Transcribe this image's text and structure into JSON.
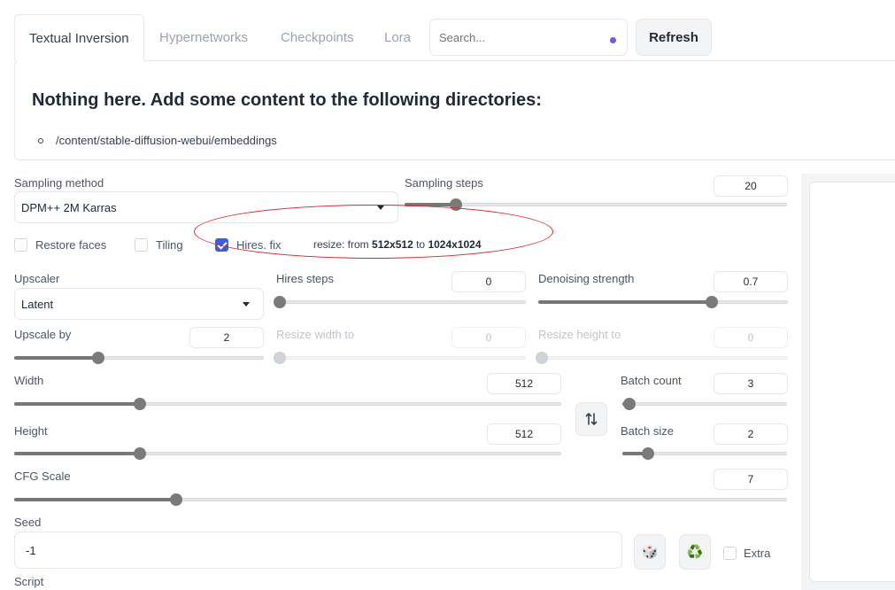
{
  "tabs": [
    {
      "label": "Textual Inversion",
      "active": true
    },
    {
      "label": "Hypernetworks",
      "active": false
    },
    {
      "label": "Checkpoints",
      "active": false
    },
    {
      "label": "Lora",
      "active": false
    }
  ],
  "search": {
    "placeholder": "Search...",
    "value": ""
  },
  "refresh_label": "Refresh",
  "empty_message": "Nothing here. Add some content to the following directories:",
  "directories": [
    "/content/stable-diffusion-webui/embeddings"
  ],
  "sampling_method": {
    "label": "Sampling method",
    "value": "DPM++ 2M Karras"
  },
  "sampling_steps": {
    "label": "Sampling steps",
    "value": "20",
    "min": 1,
    "max": 150,
    "current": 20
  },
  "checkboxes": {
    "restore_faces": {
      "label": "Restore faces",
      "checked": false
    },
    "tiling": {
      "label": "Tiling",
      "checked": false
    },
    "hires_fix": {
      "label": "Hires. fix",
      "checked": true
    }
  },
  "resize_info": {
    "prefix": "resize: from",
    "from": "512x512",
    "to_word": "to",
    "to": "1024x1024"
  },
  "upscaler": {
    "label": "Upscaler",
    "value": "Latent"
  },
  "hires_steps": {
    "label": "Hires steps",
    "value": "0",
    "min": 0,
    "max": 150,
    "current": 0
  },
  "denoising_strength": {
    "label": "Denoising strength",
    "value": "0.7",
    "min": 0,
    "max": 1,
    "current": 0.7
  },
  "upscale_by": {
    "label": "Upscale by",
    "value": "2",
    "min": 1,
    "max": 4,
    "current": 2
  },
  "resize_width": {
    "label": "Resize width to",
    "value": "0",
    "current": 0,
    "max": 2048
  },
  "resize_height": {
    "label": "Resize height to",
    "value": "0",
    "current": 0,
    "max": 2048
  },
  "width": {
    "label": "Width",
    "value": "512",
    "min": 64,
    "max": 2048,
    "current": 512
  },
  "height": {
    "label": "Height",
    "value": "512",
    "min": 64,
    "max": 2048,
    "current": 512
  },
  "batch_count": {
    "label": "Batch count",
    "value": "3",
    "min": 1,
    "max": 100,
    "current": 3
  },
  "batch_size": {
    "label": "Batch size",
    "value": "2",
    "min": 1,
    "max": 8,
    "current": 2
  },
  "swap_icon": "swap-vertical-arrows",
  "cfg_scale": {
    "label": "CFG Scale",
    "value": "7",
    "min": 1,
    "max": 30,
    "current": 7
  },
  "seed": {
    "label": "Seed",
    "value": "-1"
  },
  "dice_icon": "🎲",
  "recycle_icon": "♻️",
  "extra": {
    "label": "Extra",
    "checked": false
  },
  "script_label": "Script",
  "colors": {
    "accent": "#3b5fd9",
    "annotation": "#d9232e",
    "slider_fill": "#777777"
  }
}
